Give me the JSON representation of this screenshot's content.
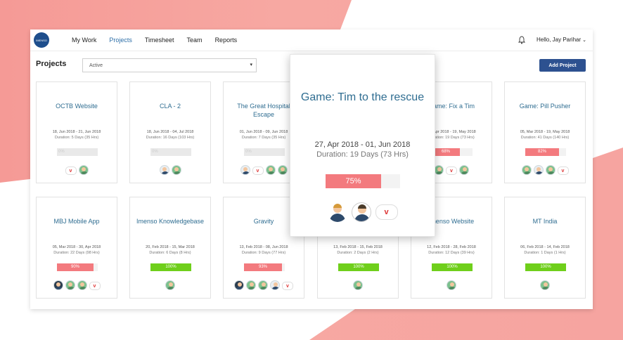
{
  "nav": {
    "logo_text": "IMENSO",
    "items": [
      "My Work",
      "Projects",
      "Timesheet",
      "Team",
      "Reports"
    ],
    "active": "Projects",
    "user": "Hello, Jay Parihar"
  },
  "subbar": {
    "title": "Projects",
    "filter_value": "Active",
    "add_label": "Add Project"
  },
  "cards": [
    {
      "title": "OCTB Website",
      "date": "18, Jun 2018 - 21, Jun 2018",
      "duration": "Duration: 5 Days (35 Hrs)",
      "progress": "0%",
      "progress_value": 0.0,
      "color": "gray"
    },
    {
      "title": "CLA - 2",
      "date": "18, Jun 2018 - 04, Jul 2018",
      "duration": "Duration: 16 Days (103 Hrs)",
      "progress": "0%",
      "progress_value": 0.0,
      "color": "gray"
    },
    {
      "title": "The Great Hospital Escape",
      "date": "01, Jun 2018 - 09, Jun 2018",
      "duration": "Duration: 7 Days (35 Hrs)",
      "progress": "0%",
      "progress_value": 0.0,
      "color": "gray"
    },
    {
      "title": "Game: Fix a Tim",
      "date": "27, Apr 2018 - 19, May 2018",
      "duration": "Duration: 19 Days (73 Hrs)",
      "progress": "68%",
      "progress_value": 0.68,
      "color": "red"
    },
    {
      "title": "Game: Pill Pusher",
      "date": "05, Mar 2018 - 19, May 2018",
      "duration": "Duration: 41 Days (140 Hrs)",
      "progress": "82%",
      "progress_value": 0.82,
      "color": "red"
    },
    {
      "title": "MBJ Mobile App",
      "date": "05, Mar 2018 - 30, Apr 2018",
      "duration": "Duration: 22 Days (98 Hrs)",
      "progress": "90%",
      "progress_value": 0.9,
      "color": "red"
    },
    {
      "title": "Imenso Knowledgebase",
      "date": "20, Feb 2018 - 15, Mar 2018",
      "duration": "Duration: 6 Days (8 Hrs)",
      "progress": "100%",
      "progress_value": 1.0,
      "color": "green"
    },
    {
      "title": "Gravity",
      "date": "13, Feb 2018 - 08, Jun 2018",
      "duration": "Duration: 9 Days (77 Hrs)",
      "progress": "93%",
      "progress_value": 0.93,
      "color": "red"
    },
    {
      "title": "",
      "date": "13, Feb 2018 - 15, Feb 2018",
      "duration": "Duration: 2 Days (2 Hrs)",
      "progress": "100%",
      "progress_value": 1.0,
      "color": "green"
    },
    {
      "title": "Imenso Website",
      "date": "12, Feb 2018 - 28, Feb 2018",
      "duration": "Duration: 12 Days (39 Hrs)",
      "progress": "100%",
      "progress_value": 1.0,
      "color": "green"
    },
    {
      "title": "MT India",
      "date": "06, Feb 2018 - 14, Feb 2018",
      "duration": "Duration: 1 Days (1 Hrs)",
      "progress": "100%",
      "progress_value": 1.0,
      "color": "green"
    }
  ],
  "popup": {
    "title": "Game: Tim to the rescue",
    "date": "27, Apr 2018 - 01, Jun 2018",
    "duration": "Duration: 19 Days (73 Hrs)",
    "progress": "75%",
    "progress_value": 0.75
  }
}
